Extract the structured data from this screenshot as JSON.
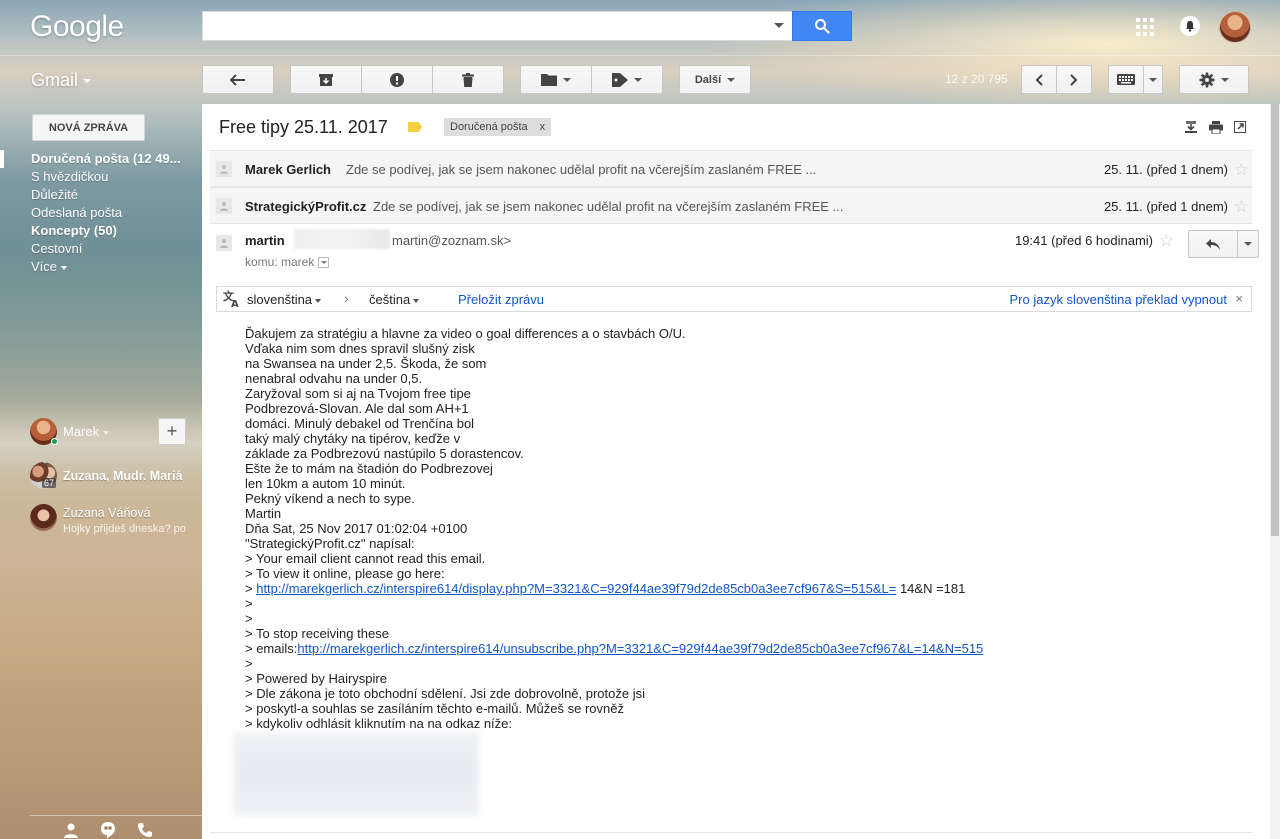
{
  "header": {
    "logo": "Google",
    "search_placeholder": "",
    "avatar_alt": "user avatar"
  },
  "app": {
    "name": "Gmail"
  },
  "toolbar": {
    "more_label": "Další",
    "pager": "12 z 20 795"
  },
  "sidebar": {
    "compose_label": "NOVÁ ZPRÁVA",
    "items": [
      {
        "label": "Doručená pošta (12 49..."
      },
      {
        "label": "S hvězdičkou"
      },
      {
        "label": "Důležité"
      },
      {
        "label": "Odeslaná pošta"
      },
      {
        "label": "Koncepty (50)"
      },
      {
        "label": "Cestovní"
      },
      {
        "label": "Více"
      }
    ]
  },
  "hangouts": {
    "self_name": "Marek",
    "contacts": [
      {
        "name": "Zuzana, Mudr. Mariá",
        "sub": "",
        "badge": "67"
      },
      {
        "name": "Zuzana Váňová",
        "sub": "Hojky přijdeš dneska? po"
      }
    ]
  },
  "thread": {
    "subject": "Free tipy 25.11. 2017",
    "label_chip": "Doručená pošta",
    "label_close": "x",
    "collapsed": [
      {
        "sender": "Marek Gerlich",
        "snippet": "Zde se podívej, jak se jsem nakonec udělal profit na včerejším zaslaném FREE ...",
        "date": "25. 11. (před 1 dnem)"
      },
      {
        "sender": "StrategickýProfit.cz",
        "snippet": "Zde se podívej, jak se jsem nakonec udělal profit na včerejším zaslaném FREE ...",
        "date": "25. 11. (před 1 dnem)"
      }
    ],
    "open": {
      "from_name": "martin",
      "from_email": "martin@zoznam.sk>",
      "to_label": "komu: marek",
      "time": "19:41 (před 6 hodinami)"
    }
  },
  "translate": {
    "source": "slovenština",
    "arrow": "›",
    "target": "čeština",
    "translate_link": "Přeložit zprávu",
    "turn_off": "Pro jazyk slovenština překlad vypnout",
    "close": "×"
  },
  "body": {
    "lines": [
      "Ďakujem za stratégiu a hlavne za video o goal differences a o stavbách O/U.",
      "Vďaka nim som dnes spravil slušný zisk",
      "na Swansea na under 2,5. Škoda, že som",
      "nenabral odvahu na under 0,5.",
      "Zaryžoval som si aj na Tvojom free tipe",
      "Podbrezová-Slovan. Ale dal som AH+1",
      "domáci. Minulý debakel od Trenčína bol",
      "taký malý chytáky na tipérov, keďže v",
      "základe za Podbrezovú nastúpilo 5 dorastencov.",
      "Ešte že to mám na štadión do Podbrezovej",
      "len 10km a autom 10 minút.",
      "Pekný víkend a nech to sype.",
      "Martin",
      "Dňa Sat, 25 Nov 2017 01:02:04 +0100",
      "\"StrategickýProfit.cz\" napísal:",
      "> Your email client cannot read this email.",
      "> To view it online, please go here:"
    ],
    "link1_prefix": "> ",
    "link1": "http://marekgerlich.cz/interspire614/display.php?M=3321&C=929f44ae39f79d2de85cb0a3ee7cf967&S=515&L=",
    "link1_suffix": " 14&N =181",
    "lines2": [
      ">",
      ">",
      "> To stop receiving these"
    ],
    "link2_prefix": "> emails:",
    "link2": "http://marekgerlich.cz/interspire614/unsubscribe.php?M=3321&C=929f44ae39f79d2de85cb0a3ee7cf967&L=14&N=515",
    "lines3": [
      ">",
      "> Powered by Hairyspire",
      "> Dle zákona je toto obchodní sdělení. Jsi zde dobrovolně, protože jsi",
      "> poskytl-a souhlas se zasíláním těchto e-mailů. Můžeš se rovněž",
      "> kdykoliv odhlásit kliknutím na na odkaz níže:"
    ]
  },
  "colors": {
    "accent_blue": "#4285f4",
    "link": "#1155cc",
    "label_yellow": "#f4d03f"
  }
}
